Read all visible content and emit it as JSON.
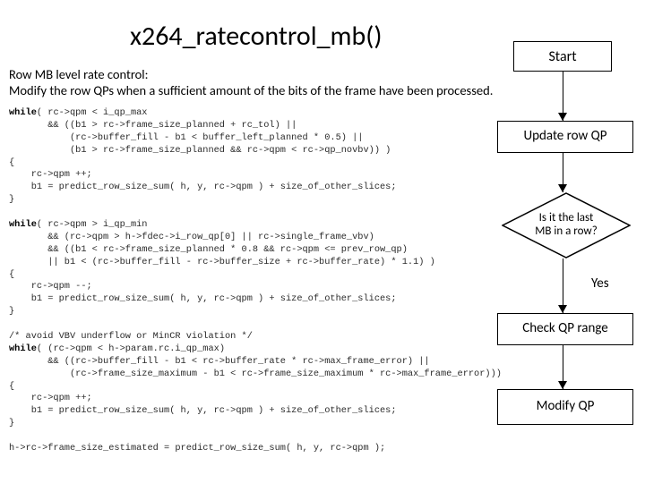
{
  "title": "x264_ratecontrol_mb()",
  "description": {
    "line1": "Row MB level rate control:",
    "line2": "Modify the row QPs when a sufficient amount of the bits of the frame have been processed."
  },
  "flow": {
    "start": "Start",
    "update_qp": "Update row QP",
    "decision": "Is it the last\nMB in a row?",
    "yes": "Yes",
    "check_range": "Check QP range",
    "modify_qp": "Modify QP"
  },
  "chart_data": {
    "type": "diagram",
    "nodes": [
      {
        "id": "start",
        "shape": "terminator",
        "label": "Start"
      },
      {
        "id": "update",
        "shape": "process",
        "label": "Update row QP"
      },
      {
        "id": "lastmb",
        "shape": "decision",
        "label": "Is it the last MB in a row?"
      },
      {
        "id": "check",
        "shape": "process",
        "label": "Check QP range"
      },
      {
        "id": "modify",
        "shape": "process",
        "label": "Modify QP"
      }
    ],
    "edges": [
      {
        "from": "start",
        "to": "update"
      },
      {
        "from": "update",
        "to": "lastmb"
      },
      {
        "from": "lastmb",
        "to": "check",
        "label": "Yes"
      },
      {
        "from": "check",
        "to": "modify"
      }
    ]
  },
  "code": "while( rc->qpm < i_qp_max\n       && ((b1 > rc->frame_size_planned + rc_tol) ||\n           (rc->buffer_fill - b1 < buffer_left_planned * 0.5) ||\n           (b1 > rc->frame_size_planned && rc->qpm < rc->qp_novbv)) )\n{\n    rc->qpm ++;\n    b1 = predict_row_size_sum( h, y, rc->qpm ) + size_of_other_slices;\n}\n\nwhile( rc->qpm > i_qp_min\n       && (rc->qpm > h->fdec->i_row_qp[0] || rc->single_frame_vbv)\n       && ((b1 < rc->frame_size_planned * 0.8 && rc->qpm <= prev_row_qp)\n       || b1 < (rc->buffer_fill - rc->buffer_size + rc->buffer_rate) * 1.1) )\n{\n    rc->qpm --;\n    b1 = predict_row_size_sum( h, y, rc->qpm ) + size_of_other_slices;\n}\n\n/* avoid VBV underflow or MinCR violation */\nwhile( (rc->qpm < h->param.rc.i_qp_max)\n       && ((rc->buffer_fill - b1 < rc->buffer_rate * rc->max_frame_error) ||\n           (rc->frame_size_maximum - b1 < rc->frame_size_maximum * rc->max_frame_error)))\n{\n    rc->qpm ++;\n    b1 = predict_row_size_sum( h, y, rc->qpm ) + size_of_other_slices;\n}\n\nh->rc->frame_size_estimated = predict_row_size_sum( h, y, rc->qpm );"
}
